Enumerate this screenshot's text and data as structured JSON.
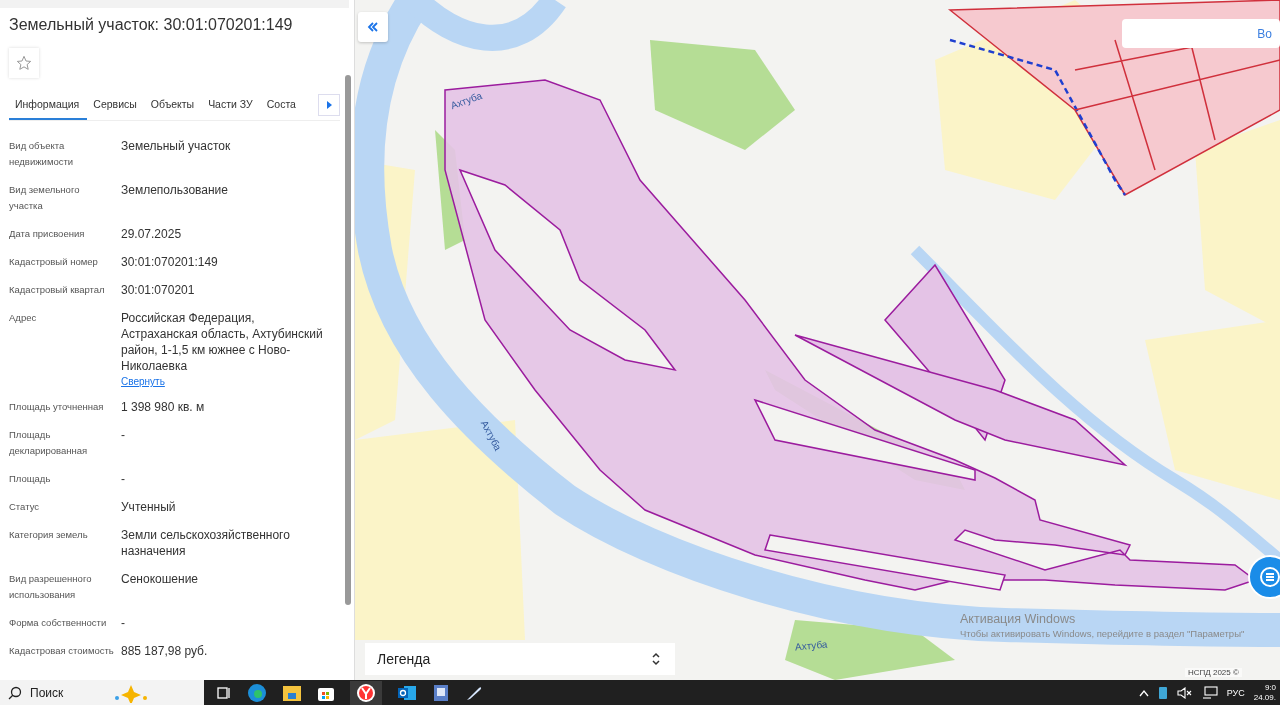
{
  "panel": {
    "title": "Земельный участок: 30:01:070201:149",
    "tabs": [
      {
        "label": "Информация",
        "selected": true
      },
      {
        "label": "Сервисы",
        "selected": false
      },
      {
        "label": "Объекты",
        "selected": false
      },
      {
        "label": "Части ЗУ",
        "selected": false
      },
      {
        "label": "Соста",
        "selected": false
      }
    ],
    "fields": [
      {
        "label": "Вид объекта недвижимости",
        "value": "Земельный участок"
      },
      {
        "label": "Вид земельного участка",
        "value": "Землепользование"
      },
      {
        "label": "Дата присвоения",
        "value": "29.07.2025"
      },
      {
        "label": "Кадастровый номер",
        "value": "30:01:070201:149"
      },
      {
        "label": "Кадастровый квартал",
        "value": "30:01:070201"
      },
      {
        "label": "Адрес",
        "value": "Российская Федерация, Астраханская область, Ахтубинский район, 1-1,5 км южнее с Ново-Николаевка",
        "link": "Свернуть"
      },
      {
        "label": "Площадь уточненная",
        "value": "1 398 980 кв. м"
      },
      {
        "label": "Площадь декларированная",
        "value": "-"
      },
      {
        "label": "Площадь",
        "value": "-"
      },
      {
        "label": "Статус",
        "value": "Учтенный"
      },
      {
        "label": "Категория земель",
        "value": "Земли сельскохозяйственного назначения"
      },
      {
        "label": "Вид разрешенного использования",
        "value": "Сенокошение"
      },
      {
        "label": "Форма собственности",
        "value": "-"
      },
      {
        "label": "Кадастровая стоимость",
        "value": "885 187,98 руб."
      }
    ]
  },
  "map": {
    "search_button": "Во",
    "river_labels": [
      "Ахтуба",
      "Ахтуба",
      "Ахтуба"
    ],
    "legend": "Легенда",
    "attribution": "НСПД 2025 ©"
  },
  "activation": {
    "title": "Активация Windows",
    "text": "Чтобы активировать Windows, перейдите в раздел \"Параметры\""
  },
  "taskbar": {
    "search": "Поиск",
    "language": "РУС",
    "time": "9:0",
    "date": "24.09."
  }
}
